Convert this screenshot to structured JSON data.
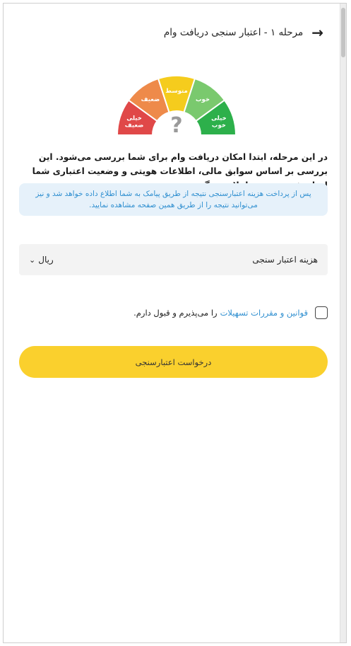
{
  "header": {
    "back_icon": "arrow-right-icon",
    "title": "مرحله ۱ - اعتبار سنجی دریافت وام"
  },
  "gauge": {
    "segments": [
      {
        "label": "خیلی ضعیف",
        "color": "#e04848"
      },
      {
        "label": "ضعیف",
        "color": "#ee8a4a"
      },
      {
        "label": "متوسط",
        "color": "#f5cc1d"
      },
      {
        "label": "خوب",
        "color": "#7ac96e"
      },
      {
        "label": "خیلی خوب",
        "color": "#2db04b"
      }
    ],
    "center_symbol": "?"
  },
  "intro": {
    "text": "در این مرحله، ابتدا امکان دریافت وام برای شما بررسی می‌شود. این بررسی بر اساس سوابق مالی، اطلاعات هویتی و وضعیت اعتباری شما انجام شده و نتیجه اعلام می‌گردد."
  },
  "info_box": {
    "text": "پس از پرداخت هزینه اعتبارسنجی نتیجه از طریق پیامک به شما اطلاع داده خواهد شد و نیز می‌توانید نتیجه را از طریق همین صفحه مشاهده نمایید."
  },
  "fee": {
    "label": "هزینه اعتبار سنجی",
    "value": "ریال",
    "chevron_icon": "chevron-down-icon"
  },
  "terms": {
    "link_text": "قوانین و مقررات تسهیلات",
    "text": "را می‌پذیرم و قبول دارم."
  },
  "submit": {
    "label": "درخواست اعتبارسنجی"
  },
  "colors": {
    "accent": "#fad02d",
    "link": "#2f8fd0",
    "info_bg": "#e6f1fa"
  }
}
